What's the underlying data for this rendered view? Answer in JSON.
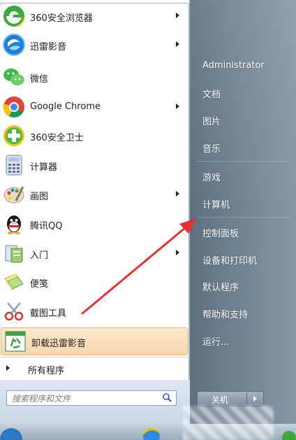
{
  "start_menu": {
    "programs": [
      {
        "label": "360安全浏览器",
        "has_submenu": true,
        "icon": "360-browser-icon"
      },
      {
        "label": "迅雷影音",
        "has_submenu": true,
        "icon": "xunlei-player-icon"
      },
      {
        "label": "微信",
        "has_submenu": false,
        "icon": "wechat-icon"
      },
      {
        "label": "Google Chrome",
        "has_submenu": true,
        "icon": "chrome-icon"
      },
      {
        "label": "360安全卫士",
        "has_submenu": false,
        "icon": "360-safeguard-icon"
      },
      {
        "label": "计算器",
        "has_submenu": false,
        "icon": "calculator-icon"
      },
      {
        "label": "画图",
        "has_submenu": true,
        "icon": "paint-icon"
      },
      {
        "label": "腾讯QQ",
        "has_submenu": false,
        "icon": "qq-penguin-icon"
      },
      {
        "label": "入门",
        "has_submenu": true,
        "icon": "getting-started-icon"
      },
      {
        "label": "便笺",
        "has_submenu": false,
        "icon": "sticky-notes-icon"
      },
      {
        "label": "截图工具",
        "has_submenu": false,
        "icon": "snipping-tool-icon"
      },
      {
        "label": "卸载迅雷影音",
        "has_submenu": false,
        "icon": "recycle-uninstall-icon",
        "highlighted": true
      }
    ],
    "all_programs_label": "所有程序",
    "search_placeholder": "搜索程序和文件",
    "right_panel": {
      "items": [
        "Administrator",
        "文档",
        "图片",
        "音乐",
        "游戏",
        "计算机",
        "控制面板",
        "设备和打印机",
        "默认程序",
        "帮助和支持",
        "运行..."
      ]
    },
    "shutdown_label": "关机"
  },
  "colors": {
    "highlight": "#f8d6aa",
    "annotation_arrow": "#e63232"
  }
}
